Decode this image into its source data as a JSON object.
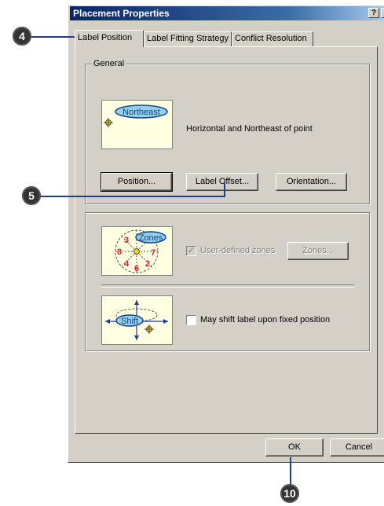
{
  "window": {
    "title": "Placement Properties",
    "help_button": "?",
    "close_button": "×"
  },
  "tabs": [
    {
      "label": "Label Position",
      "active": true
    },
    {
      "label": "Label Fitting Strategy",
      "active": false
    },
    {
      "label": "Conflict Resolution",
      "active": false
    }
  ],
  "general": {
    "legend": "General",
    "preview_label": "Northeast",
    "description": "Horizontal and Northeast of point",
    "position_button": "Position...",
    "label_offset_button": "Label Offset...",
    "orientation_button": "Orientation..."
  },
  "zones": {
    "preview_label": "Zones",
    "numbers": [
      "3",
      "8",
      "4",
      "6",
      "2",
      "7"
    ],
    "checkbox_label": "User-defined zones",
    "checkbox_checked": true,
    "checkbox_enabled": false,
    "zones_button": "Zones...",
    "zones_button_enabled": false
  },
  "shift": {
    "preview_label": "Shift",
    "checkbox_label": "May shift label upon fixed position",
    "checkbox_checked": false
  },
  "footer": {
    "ok_button": "OK",
    "cancel_button": "Cancel"
  },
  "callouts": [
    "4",
    "5",
    "10"
  ],
  "colors": {
    "title_bar": "#0a246a",
    "dialog_face": "#d4d0c8",
    "preview_bg": "#ffffe1",
    "label_fill": "#8fd1e8",
    "callout": "#333333",
    "leader": "#1d3f8c",
    "zone_numbers": "#e02020"
  }
}
